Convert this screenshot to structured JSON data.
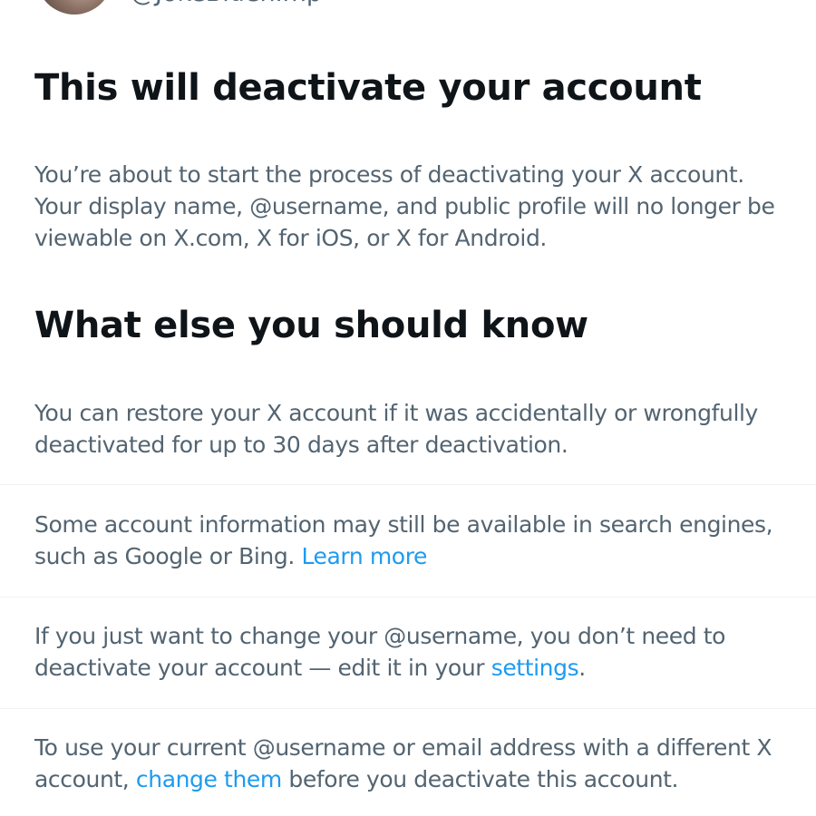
{
  "header": {
    "handle": "@JokeBidenImp"
  },
  "sections": {
    "title_deactivate": "This will deactivate your account",
    "intro_text": "You’re about to start the process of deactivating your X account. Your display name, @username, and public profile will no longer be viewable on X.com, X for iOS, or X for Android.",
    "title_know": "What else you should know",
    "restore_text": "You can restore your X account if it was accidentally or wrongfully deactivated for up to 30 days after deactivation.",
    "search_text": "Some account information may still be available in search engines, such as Google or Bing.",
    "search_link": "Learn more",
    "username_text": "If you just want to change your @username, you don’t need to deactivate your account — edit it in your",
    "username_link": "settings",
    "username_end": ".",
    "email_text_before": "To use your current @username or email address with a different X account,",
    "email_link": "change them",
    "email_text_after": "before you deactivate this account."
  },
  "colors": {
    "heading": "#0f1419",
    "body": "#536471",
    "link": "#1d9bf0",
    "divider": "#eff3f4"
  }
}
